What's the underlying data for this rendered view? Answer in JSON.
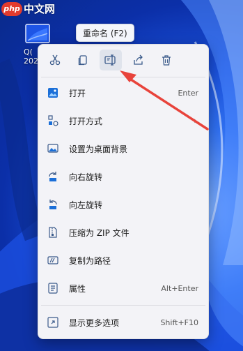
{
  "watermark": {
    "logo": "php",
    "text": "中文网"
  },
  "desktop_file": {
    "label": "Q(\n202"
  },
  "tooltip": {
    "text": "重命名 (F2)"
  },
  "quick_actions": [
    {
      "name": "cut",
      "icon": "scissors-icon"
    },
    {
      "name": "copy",
      "icon": "copy-icon"
    },
    {
      "name": "rename",
      "icon": "rename-icon"
    },
    {
      "name": "share",
      "icon": "share-icon"
    },
    {
      "name": "delete",
      "icon": "trash-icon"
    }
  ],
  "menu_items": [
    {
      "label": "打开",
      "shortcut": "Enter",
      "icon": "photos-icon"
    },
    {
      "label": "打开方式",
      "shortcut": "",
      "submenu": true,
      "icon": "open-with-icon"
    },
    {
      "label": "设置为桌面背景",
      "shortcut": "",
      "icon": "wallpaper-icon"
    },
    {
      "label": "向右旋转",
      "shortcut": "",
      "icon": "rotate-right-icon"
    },
    {
      "label": "向左旋转",
      "shortcut": "",
      "icon": "rotate-left-icon"
    },
    {
      "label": "压缩为 ZIP 文件",
      "shortcut": "",
      "icon": "zip-icon"
    },
    {
      "label": "复制为路径",
      "shortcut": "",
      "icon": "copy-path-icon"
    },
    {
      "label": "属性",
      "shortcut": "Alt+Enter",
      "icon": "properties-icon"
    },
    {
      "label": "显示更多选项",
      "shortcut": "Shift+F10",
      "icon": "more-options-icon"
    }
  ],
  "colors": {
    "arrow": "#e8433b",
    "accent": "#0067c0"
  }
}
